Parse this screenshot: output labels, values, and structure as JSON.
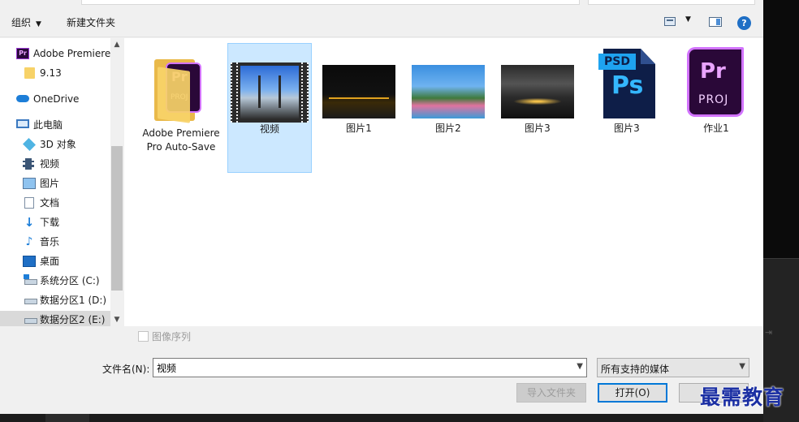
{
  "toolbar": {
    "organize": "组织",
    "new_folder": "新建文件夹"
  },
  "nav": {
    "items": [
      {
        "label": "Adobe Premiere",
        "icon": "premiere-icon"
      },
      {
        "label": "9.13",
        "icon": "folder-icon"
      },
      {
        "label": "OneDrive",
        "icon": "onedrive-icon"
      },
      {
        "label": "此电脑",
        "icon": "computer-icon"
      },
      {
        "label": "3D 对象",
        "icon": "3d-objects-icon"
      },
      {
        "label": "视频",
        "icon": "videos-icon"
      },
      {
        "label": "图片",
        "icon": "pictures-icon"
      },
      {
        "label": "文档",
        "icon": "documents-icon"
      },
      {
        "label": "下载",
        "icon": "downloads-icon"
      },
      {
        "label": "音乐",
        "icon": "music-icon"
      },
      {
        "label": "桌面",
        "icon": "desktop-icon"
      },
      {
        "label": "系统分区 (C:)",
        "icon": "drive-c-icon"
      },
      {
        "label": "数据分区1 (D:)",
        "icon": "drive-d-icon"
      },
      {
        "label": "数据分区2 (E:)",
        "icon": "drive-e-icon"
      }
    ]
  },
  "files": [
    {
      "name": "Adobe Premiere Pro Auto-Save",
      "kind": "folder"
    },
    {
      "name": "视频",
      "kind": "video"
    },
    {
      "name": "图片1",
      "kind": "image"
    },
    {
      "name": "图片2",
      "kind": "image"
    },
    {
      "name": "图片3",
      "kind": "image"
    },
    {
      "name": "图片3",
      "kind": "psd"
    },
    {
      "name": "作业1",
      "kind": "prproj"
    }
  ],
  "thumb_text": {
    "pr": "Pr",
    "proj": "PROJ",
    "ps": "Ps",
    "psd": "PSD"
  },
  "image_sequence": "图像序列",
  "filename": {
    "label": "文件名(N):",
    "value": "视频"
  },
  "filetype": {
    "value": "所有支持的媒体"
  },
  "buttons": {
    "import_folder": "导入文件夹",
    "open": "打开(O)"
  },
  "watermark": "最需教育"
}
